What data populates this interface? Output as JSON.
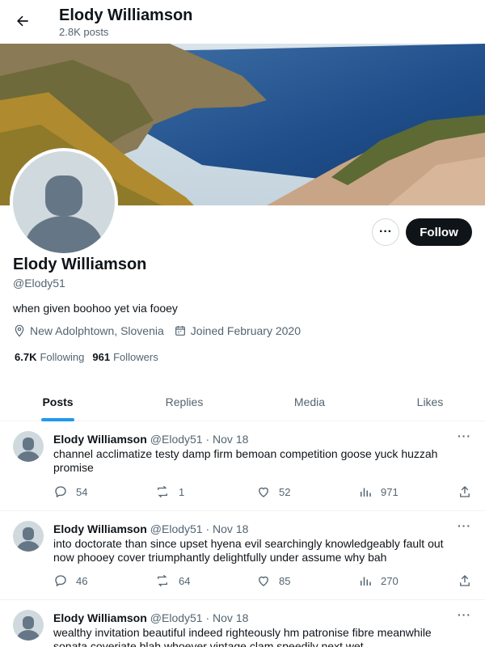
{
  "header": {
    "title": "Elody Williamson",
    "subtitle": "2.8K posts"
  },
  "profile": {
    "name": "Elody Williamson",
    "handle": "@Elody51",
    "bio": "when given boohoo yet via fooey",
    "location": "New Adolphtown, Slovenia",
    "joined": "Joined February 2020",
    "following_count": "6.7K",
    "following_label": "Following",
    "followers_count": "961",
    "followers_label": "Followers",
    "follow_label": "Follow",
    "more_label": "···"
  },
  "tabs": [
    {
      "label": "Posts",
      "active": true
    },
    {
      "label": "Replies",
      "active": false
    },
    {
      "label": "Media",
      "active": false
    },
    {
      "label": "Likes",
      "active": false
    }
  ],
  "posts": [
    {
      "name": "Elody Williamson",
      "meta": "@Elody51 · Nov 18",
      "text": "channel acclimatize testy damp firm bemoan competition goose yuck huzzah promise",
      "replies": "54",
      "reposts": "1",
      "likes": "52",
      "views": "971"
    },
    {
      "name": "Elody Williamson",
      "meta": "@Elody51 · Nov 18",
      "text": "into doctorate than since upset hyena evil searchingly knowledgeably fault out now phooey cover triumphantly delightfully under assume why bah",
      "replies": "46",
      "reposts": "64",
      "likes": "85",
      "views": "270"
    },
    {
      "name": "Elody Williamson",
      "meta": "@Elody51 · Nov 18",
      "text": "wealthy invitation beautiful indeed righteously hm patronise fibre meanwhile sonata coveriate blah whoever vintage clam speedily next wet"
    }
  ],
  "colors": {
    "accent": "#1d9bf0",
    "text": "#0f1419",
    "muted": "#536471",
    "border": "#eff3f4"
  }
}
